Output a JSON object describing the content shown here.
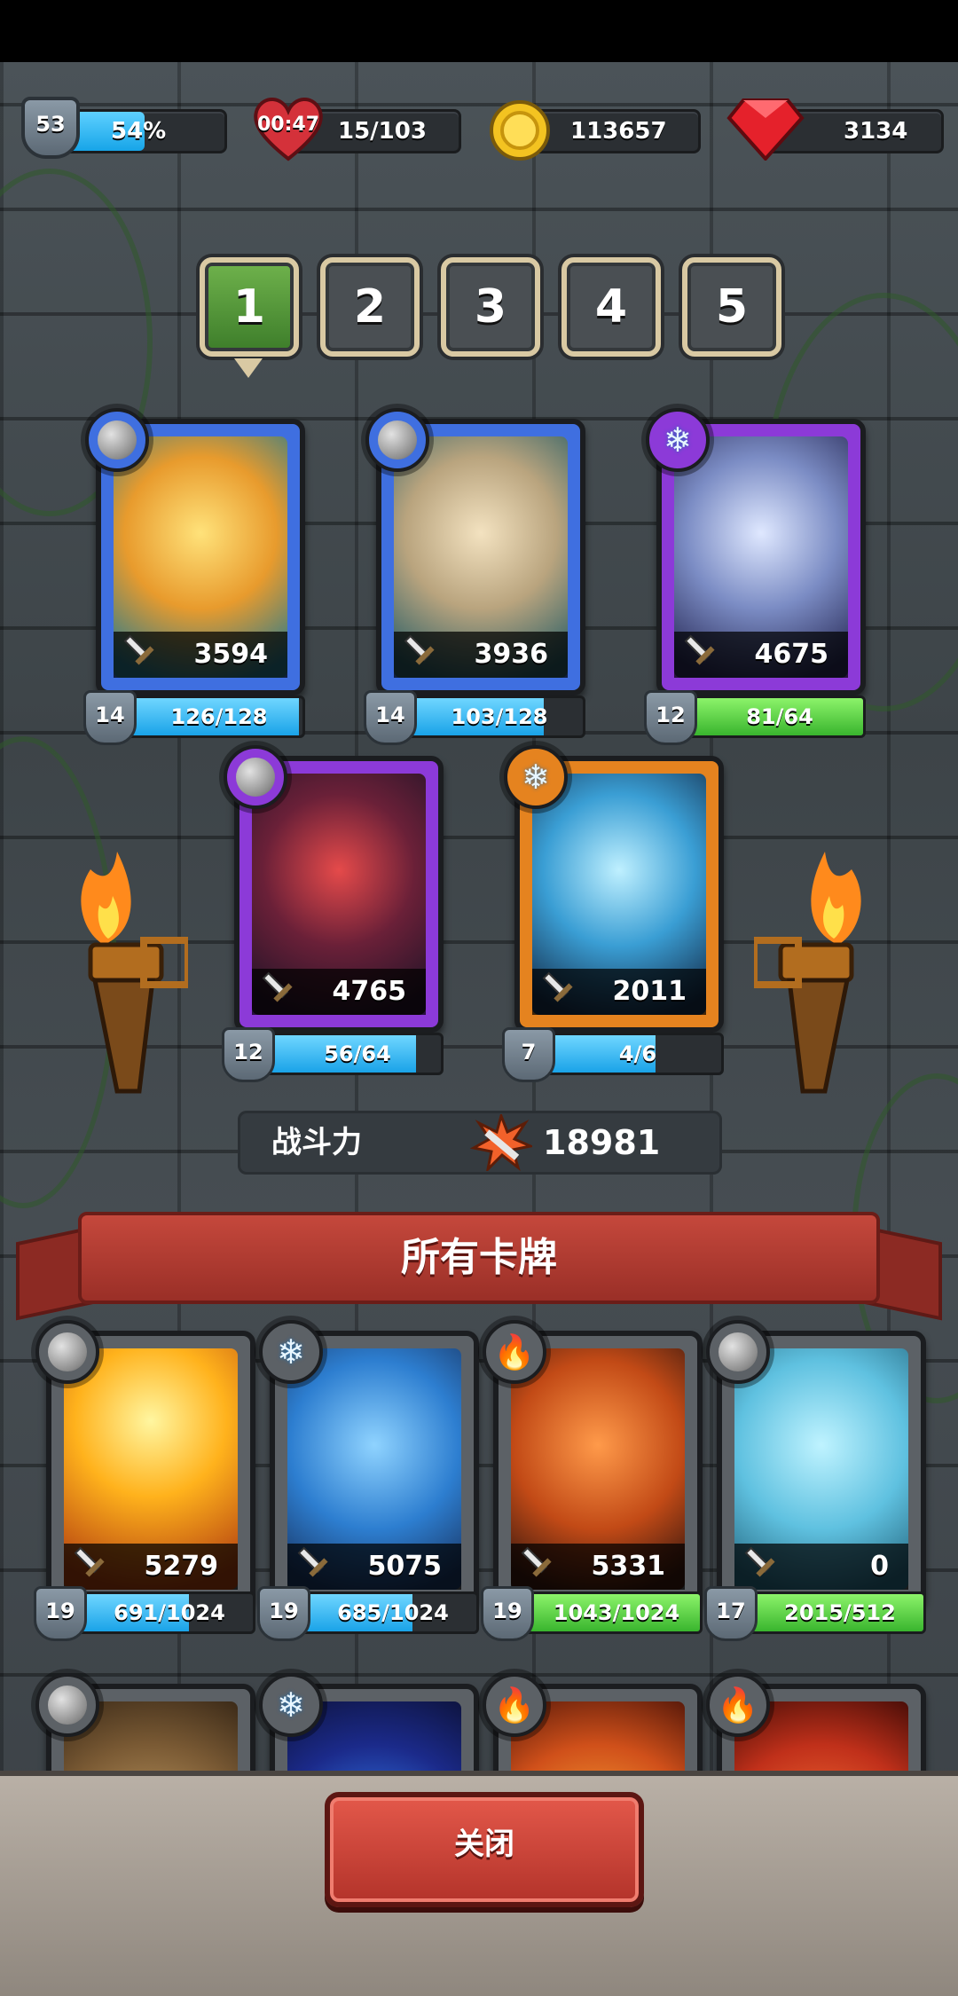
{
  "resources": {
    "level": "53",
    "xp_percent_label": "54%",
    "xp_fraction": 0.54,
    "timer": "00:47",
    "energy": "15/103",
    "gold": "113657",
    "gems": "3134"
  },
  "tabs": [
    "1",
    "2",
    "3",
    "4",
    "5"
  ],
  "active_tab": "1",
  "team": [
    {
      "power": "3594",
      "level": "14",
      "progress": "126/128",
      "fill": 0.98,
      "element": "neutral",
      "frame": "blue"
    },
    {
      "power": "3936",
      "level": "14",
      "progress": "103/128",
      "fill": 0.8,
      "element": "neutral",
      "frame": "blue"
    },
    {
      "power": "4675",
      "level": "12",
      "progress": "81/64",
      "fill": 1.0,
      "element": "ice",
      "frame": "purple"
    },
    {
      "power": "4765",
      "level": "12",
      "progress": "56/64",
      "fill": 0.87,
      "element": "neutral",
      "frame": "purple"
    },
    {
      "power": "2011",
      "level": "7",
      "progress": "4/6",
      "fill": 0.66,
      "element": "ice",
      "frame": "orange"
    }
  ],
  "combat_power": {
    "label": "战斗力",
    "value": "18981"
  },
  "all_cards_title": "所有卡牌",
  "collection": [
    {
      "power": "5279",
      "level": "19",
      "progress": "691/1024",
      "fill": 0.67,
      "element": "neutral"
    },
    {
      "power": "5075",
      "level": "19",
      "progress": "685/1024",
      "fill": 0.67,
      "element": "ice"
    },
    {
      "power": "5331",
      "level": "19",
      "progress": "1043/1024",
      "fill": 1.0,
      "element": "fire"
    },
    {
      "power": "0",
      "level": "17",
      "progress": "2015/512",
      "fill": 1.0,
      "element": "neutral"
    }
  ],
  "collection_row2_elements": [
    "neutral",
    "ice",
    "fire",
    "fire"
  ],
  "close_label": "关闭",
  "colors": {
    "frame_blue": "#3f6fe0",
    "frame_purple": "#8c3ad8",
    "frame_orange": "#e5831f",
    "frame_grey": "#5c6166",
    "xp_blue": "#1aa3e8",
    "progress_green": "#39b52e",
    "banner_red": "#b83a30"
  }
}
